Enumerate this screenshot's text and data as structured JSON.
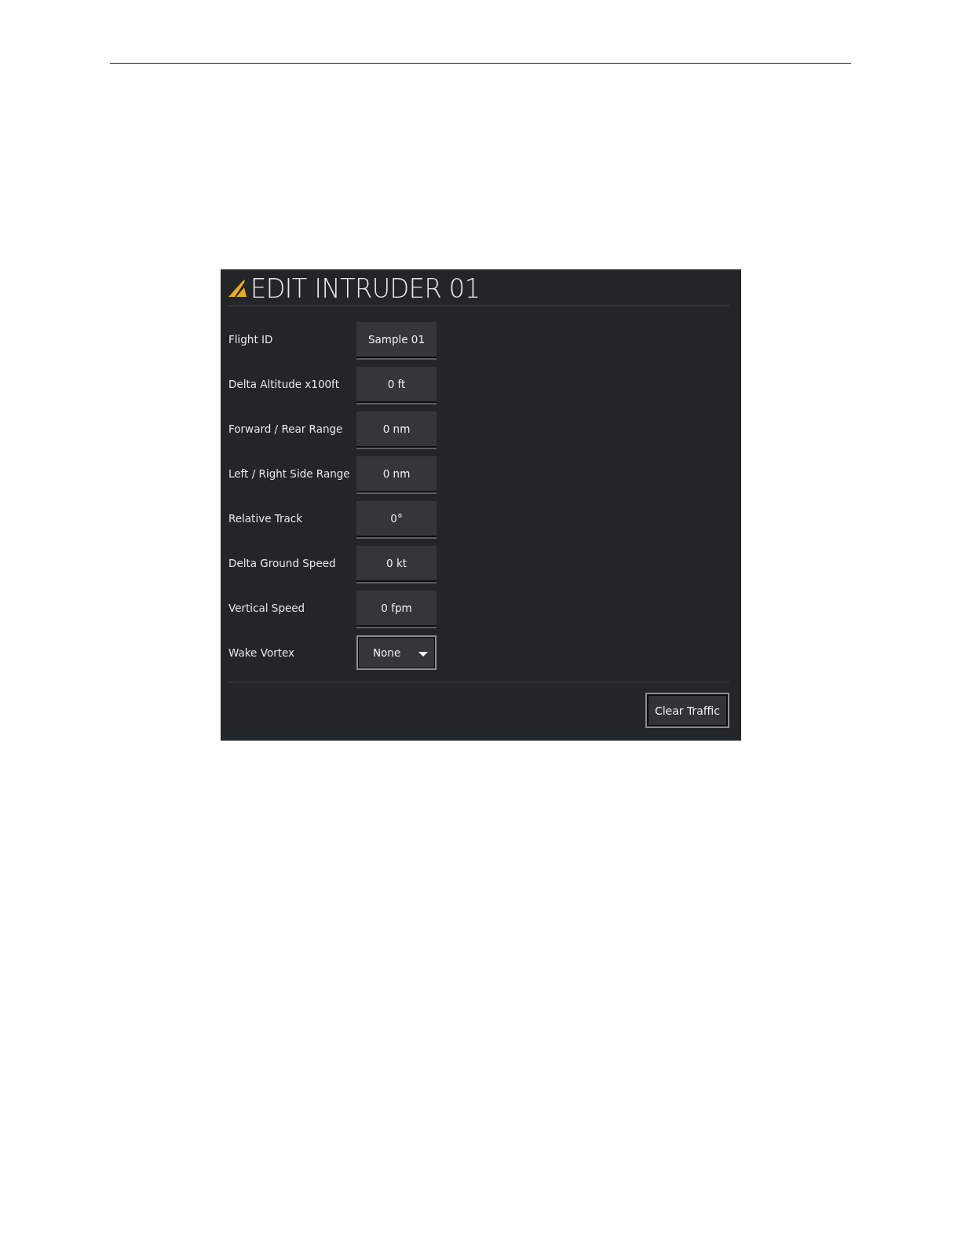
{
  "title": "EDIT INTRUDER 01",
  "fields": [
    {
      "kind": "field",
      "label": "Flight ID",
      "value": "Sample 01"
    },
    {
      "kind": "field",
      "label": "Delta Altitude x100ft",
      "value": "0 ft"
    },
    {
      "kind": "field",
      "label": "Forward / Rear Range",
      "value": "0 nm"
    },
    {
      "kind": "field",
      "label": "Left / Right Side Range",
      "value": "0 nm"
    },
    {
      "kind": "field",
      "label": "Relative Track",
      "value": "0°"
    },
    {
      "kind": "field",
      "label": "Delta Ground Speed",
      "value": "0 kt"
    },
    {
      "kind": "field",
      "label": "Vertical Speed",
      "value": "0 fpm"
    },
    {
      "kind": "dropdown",
      "label": "Wake Vortex",
      "value": "None"
    }
  ],
  "buttons": [
    "Clear Traffic"
  ]
}
